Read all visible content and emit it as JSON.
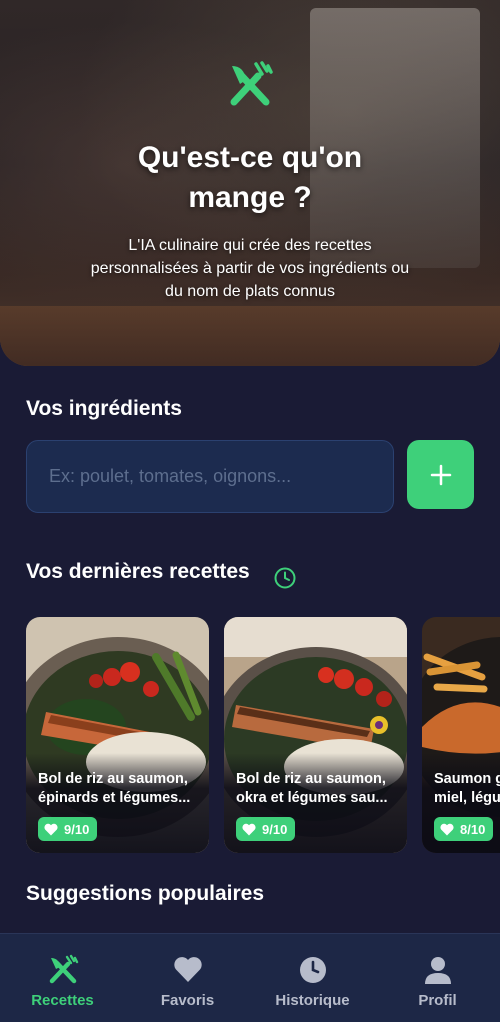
{
  "colors": {
    "accent": "#3ed07a",
    "background": "#1a1b35",
    "input_bg": "#1c2b4f",
    "nav_bg": "#1d2746"
  },
  "hero": {
    "logo_icon": "fork-knife-icon",
    "title_line1": "Qu'est-ce qu'on",
    "title_line2": "mange ?",
    "subtitle_line1": "L'IA culinaire qui crée des recettes",
    "subtitle_line2": "personnalisées à partir de vos ingrédients ou",
    "subtitle_line3": "du nom de plats connus"
  },
  "ingredients": {
    "title": "Vos ingrédients",
    "placeholder": "Ex: poulet, tomates, oignons...",
    "add_icon": "plus-icon"
  },
  "recent": {
    "title": "Vos dernières recettes",
    "icon": "clock-icon",
    "cards": [
      {
        "line1": "Bol de riz au saumon,",
        "line2": "épinards et légumes...",
        "rating": "9/10"
      },
      {
        "line1": "Bol de riz au saumon,",
        "line2": "okra et légumes sau...",
        "rating": "9/10"
      },
      {
        "line1": "Saumon g",
        "line2": "miel, légu",
        "rating": "8/10"
      }
    ]
  },
  "popular": {
    "title": "Suggestions populaires"
  },
  "nav": {
    "items": [
      {
        "label": "Recettes",
        "icon": "fork-knife-icon",
        "active": true
      },
      {
        "label": "Favoris",
        "icon": "heart-icon",
        "active": false
      },
      {
        "label": "Historique",
        "icon": "clock-icon",
        "active": false
      },
      {
        "label": "Profil",
        "icon": "user-icon",
        "active": false
      }
    ]
  }
}
